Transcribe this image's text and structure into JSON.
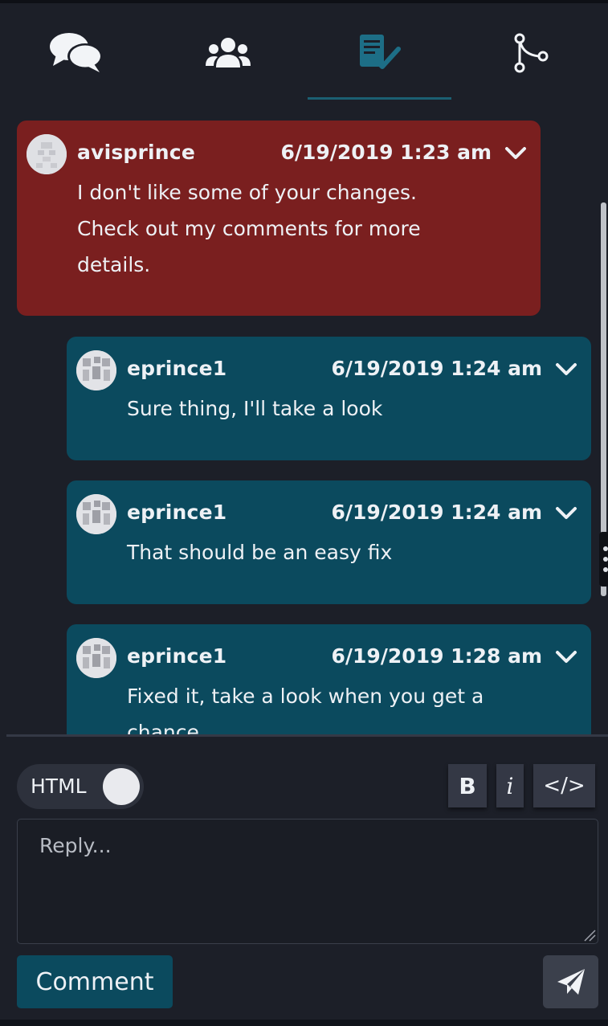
{
  "colors": {
    "root_comment_bg": "#7a1f1f",
    "reply_comment_bg": "#0b4a5e",
    "panel_bg": "#1c1f28",
    "active_tab_accent": "#1b5f72",
    "icon_color": "#f2f4f7"
  },
  "tabs": [
    {
      "icon": "chat-bubbles-icon",
      "active": false
    },
    {
      "icon": "users-icon",
      "active": false
    },
    {
      "icon": "review-checklist-icon",
      "active": true
    },
    {
      "icon": "branch-icon",
      "active": false
    }
  ],
  "comments": [
    {
      "author": "avisprince",
      "timestamp": "6/19/2019 1:23 am",
      "lines": [
        "I don't like some of your changes.",
        "Check out my comments for more",
        "details."
      ],
      "type": "root"
    },
    {
      "author": "eprince1",
      "timestamp": "6/19/2019 1:24 am",
      "lines": [
        "Sure thing, I'll take a look"
      ],
      "type": "reply"
    },
    {
      "author": "eprince1",
      "timestamp": "6/19/2019 1:24 am",
      "lines": [
        "That should be an easy fix"
      ],
      "type": "reply"
    },
    {
      "author": "eprince1",
      "timestamp": "6/19/2019 1:28 am",
      "lines": [
        "Fixed it, take a look when you get a",
        "chance."
      ],
      "type": "reply"
    }
  ],
  "composer": {
    "html_toggle_label": "HTML",
    "bold_label": "B",
    "italic_label": "i",
    "code_label": "</>",
    "reply_placeholder": "Reply...",
    "reply_value": "",
    "comment_button_label": "Comment",
    "send_icon": "send-icon"
  }
}
